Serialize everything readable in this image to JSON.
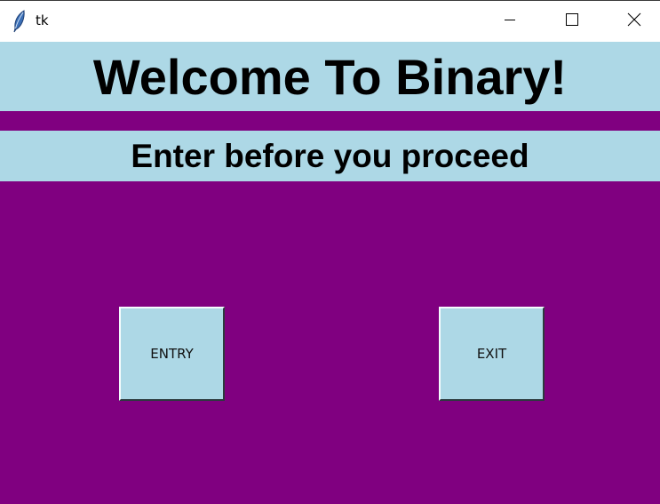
{
  "window": {
    "title": "tk",
    "icon": "tk-feather-icon",
    "controls": {
      "minimize": "minimize-icon",
      "maximize": "maximize-icon",
      "close": "close-icon"
    }
  },
  "header": {
    "welcome": "Welcome To Binary!",
    "subtitle": "Enter before you proceed"
  },
  "actions": {
    "entry_label": "ENTRY",
    "exit_label": "EXIT"
  },
  "colors": {
    "background": "#800080",
    "banner": "#add8e6",
    "button": "#add8e6",
    "text": "#000000"
  }
}
